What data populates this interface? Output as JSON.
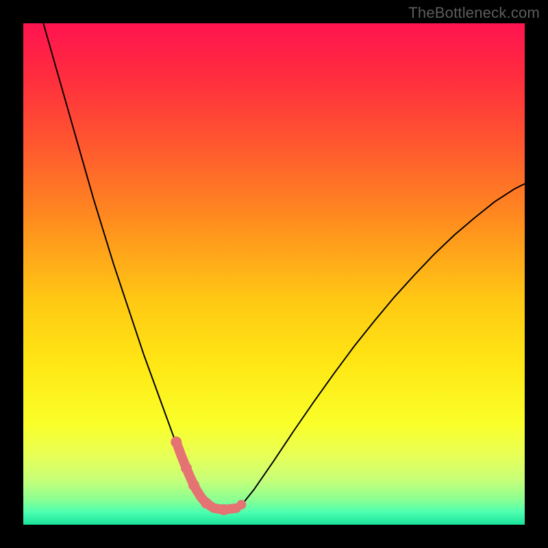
{
  "watermark": "TheBottleneck.com",
  "chart_data": {
    "type": "line",
    "title": "",
    "xlabel": "",
    "ylabel": "",
    "xlim": [
      0,
      100
    ],
    "ylim": [
      0,
      100
    ],
    "grid": false,
    "legend": false,
    "background_gradient_stops": [
      {
        "offset": 0.0,
        "color": "#ff1450"
      },
      {
        "offset": 0.1,
        "color": "#ff2b3f"
      },
      {
        "offset": 0.25,
        "color": "#ff5a2e"
      },
      {
        "offset": 0.4,
        "color": "#ff8f1e"
      },
      {
        "offset": 0.55,
        "color": "#ffc814"
      },
      {
        "offset": 0.68,
        "color": "#ffe714"
      },
      {
        "offset": 0.8,
        "color": "#faff2a"
      },
      {
        "offset": 0.86,
        "color": "#e8ff55"
      },
      {
        "offset": 0.91,
        "color": "#c7ff78"
      },
      {
        "offset": 0.95,
        "color": "#8bff92"
      },
      {
        "offset": 0.975,
        "color": "#4dffb0"
      },
      {
        "offset": 1.0,
        "color": "#19e39b"
      }
    ],
    "series": [
      {
        "name": "curve",
        "type": "line",
        "stroke": "#000000",
        "stroke_width": 2,
        "x": [
          4,
          6,
          8,
          10,
          12,
          14,
          16,
          18,
          20,
          22,
          24,
          26,
          28,
          30,
          31,
          32,
          33,
          34,
          35,
          36,
          37,
          38,
          39,
          40,
          42,
          44,
          46,
          50,
          54,
          58,
          62,
          66,
          70,
          74,
          78,
          82,
          86,
          90,
          94,
          98,
          100
        ],
        "y": [
          100,
          93,
          86,
          79,
          72,
          65,
          58.5,
          52,
          46,
          40,
          34,
          28.5,
          23,
          17.5,
          14.8,
          12.3,
          9.9,
          7.7,
          6.0,
          4.6,
          3.7,
          3.2,
          3.0,
          3.0,
          3.2,
          4.5,
          7.0,
          12.8,
          18.8,
          24.6,
          30.2,
          35.6,
          40.6,
          45.4,
          49.8,
          54.0,
          57.8,
          61.2,
          64.4,
          67.0,
          68.0
        ]
      },
      {
        "name": "trough-highlight",
        "type": "line",
        "stroke": "#e57373",
        "stroke_width": 14,
        "linecap": "round",
        "x": [
          30.5,
          31.5,
          32.5,
          33.5,
          34.5,
          35.5,
          36.5,
          38.0,
          40.0,
          42.5
        ],
        "y": [
          16.5,
          13.8,
          11.3,
          9.0,
          7.0,
          5.4,
          4.3,
          3.3,
          3.0,
          3.3
        ]
      }
    ],
    "markers": [
      {
        "x": 30.5,
        "y": 16.5,
        "r": 8,
        "fill": "#e57373"
      },
      {
        "x": 32.5,
        "y": 11.3,
        "r": 8,
        "fill": "#e57373"
      },
      {
        "x": 34.0,
        "y": 7.9,
        "r": 8,
        "fill": "#e57373"
      },
      {
        "x": 36.5,
        "y": 4.3,
        "r": 8,
        "fill": "#e57373"
      },
      {
        "x": 40.0,
        "y": 3.0,
        "r": 8,
        "fill": "#e57373"
      },
      {
        "x": 43.5,
        "y": 4.0,
        "r": 7,
        "fill": "#e57373"
      }
    ]
  }
}
